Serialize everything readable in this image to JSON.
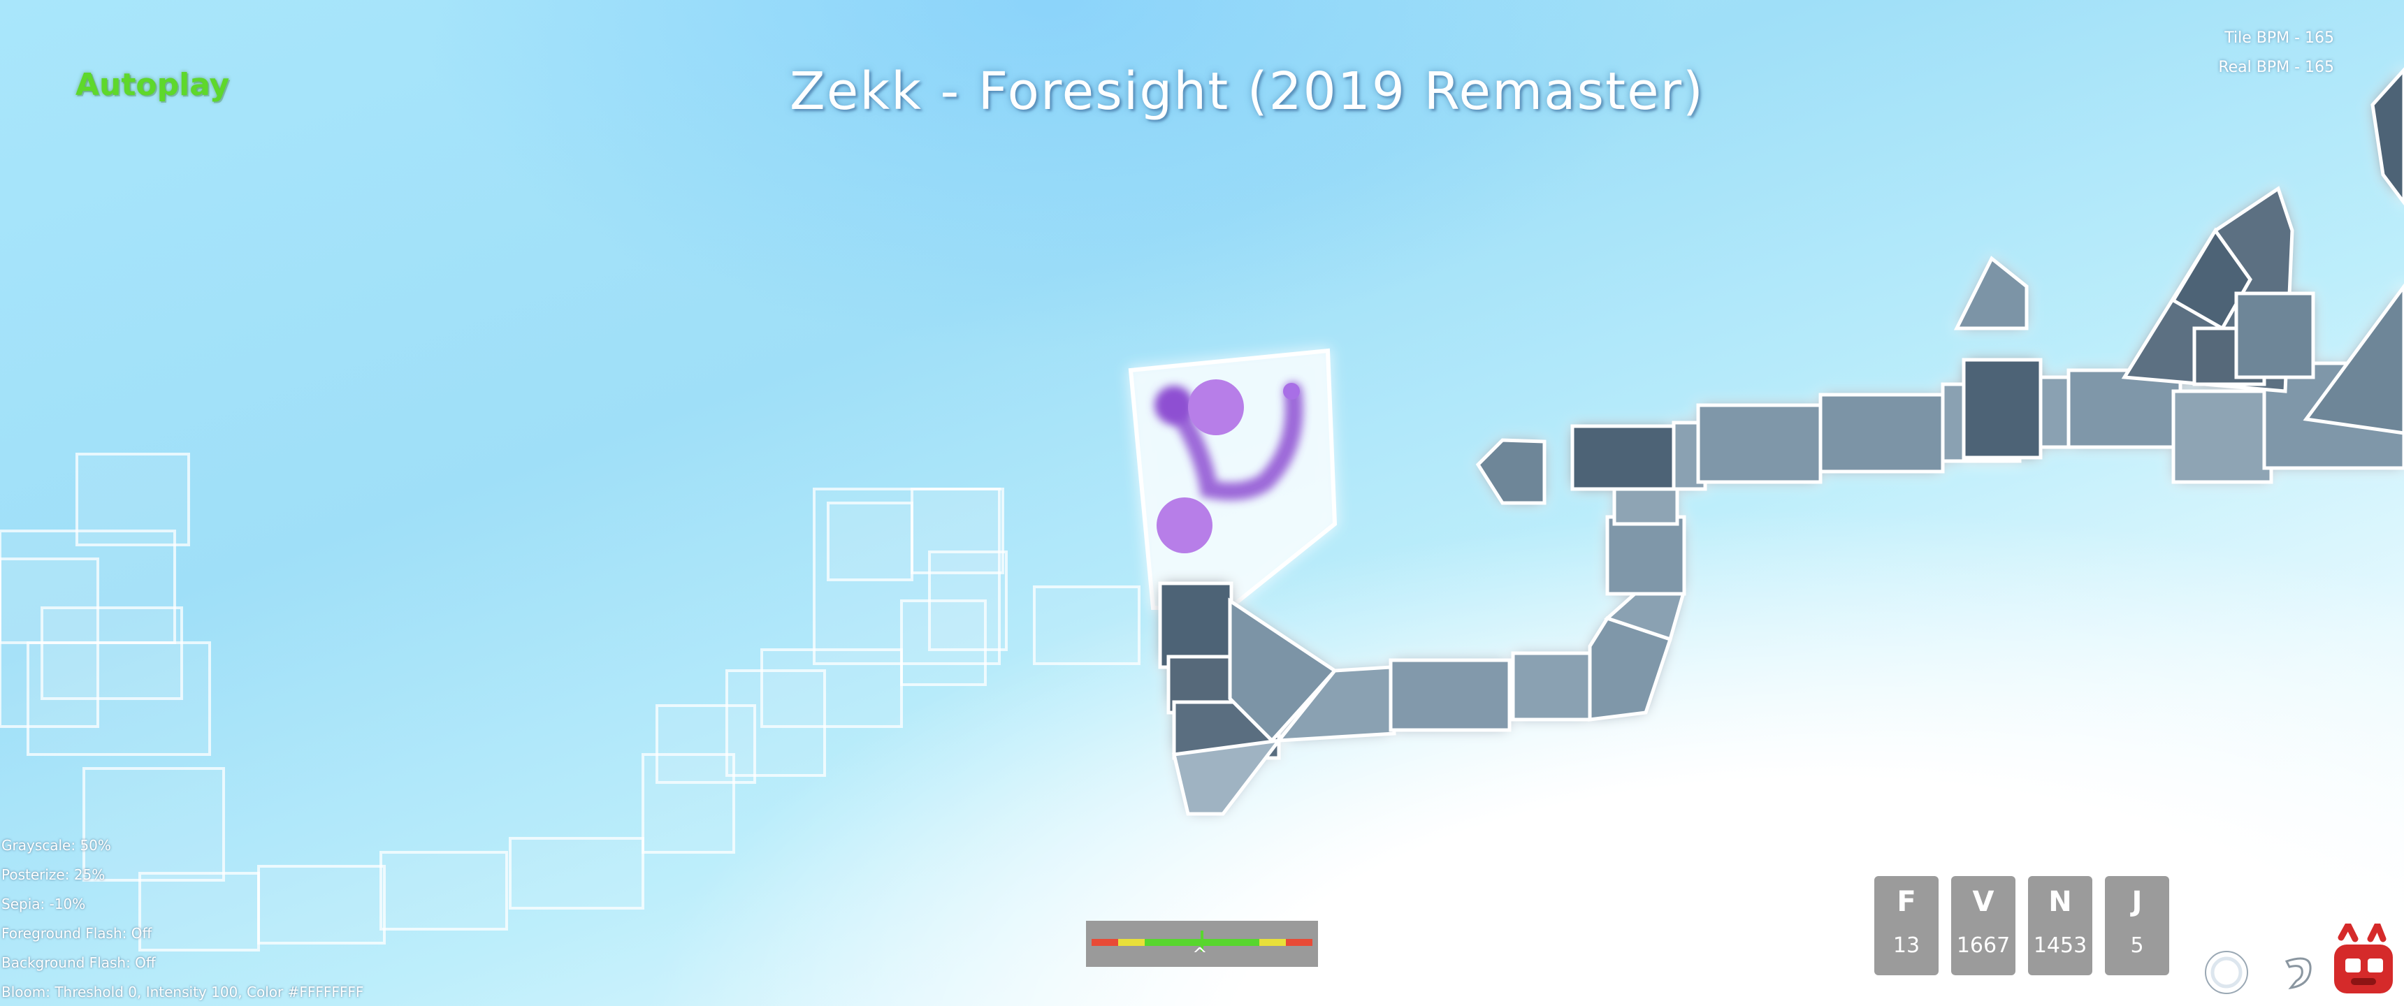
{
  "hud": {
    "autoplay_label": "Autoplay",
    "song_title": "Zekk - Foresight (2019 Remaster)",
    "tile_bpm": "Tile BPM - 165",
    "real_bpm": "Real BPM - 165"
  },
  "effects": [
    "Grayscale: 50%",
    "Posterize: 25%",
    "Sepia: -10%",
    "Foreground Flash: Off",
    "Background Flash: Off",
    "Bloom: Threshold 0, Intensity 100, Color #FFFFFFFF"
  ],
  "judgements": [
    {
      "label": "F",
      "value": "13"
    },
    {
      "label": "V",
      "value": "1667"
    },
    {
      "label": "N",
      "value": "1453"
    },
    {
      "label": "J",
      "value": "5"
    }
  ],
  "timing_bar": {
    "caret": "^",
    "colors": [
      "#e84a36",
      "#e8e03a",
      "#58d62e"
    ]
  },
  "icons": [
    "spiral-icon",
    "hook-icon",
    "mascot-icon"
  ],
  "colors": {
    "tile_dark": "#4e6476",
    "tile_mid": "#7b94a6",
    "tile_light": "#9fb3c2",
    "planet": "#b77ee8",
    "planet_trail": "#8e4fd2",
    "autoplay_text": "#5ed82b",
    "judge_box": "#9b9b9b"
  }
}
